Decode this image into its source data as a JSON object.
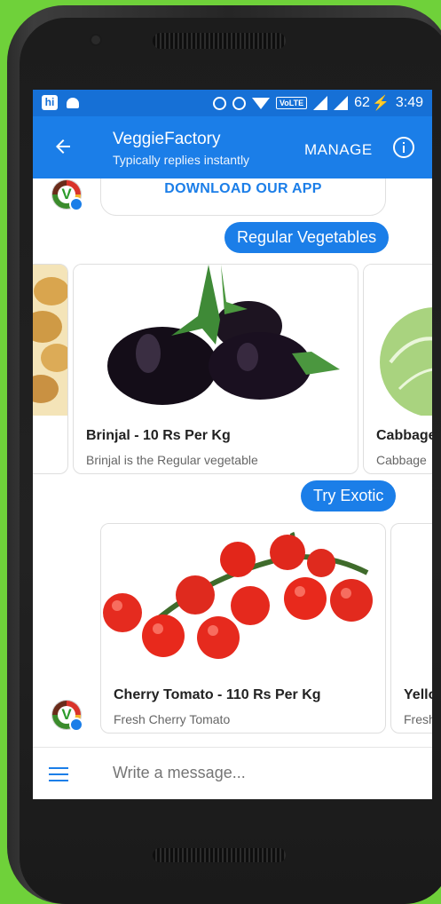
{
  "statusbar": {
    "hi": "hi",
    "volte": "VoLTE",
    "battery": "62",
    "time": "3:49"
  },
  "appbar": {
    "title": "VeggieFactory",
    "subtitle": "Typically replies instantly",
    "manage": "MANAGE"
  },
  "chat": {
    "download_button": "DOWNLOAD OUR APP",
    "bubble_regular": "Regular Vegetables",
    "regular_cards": [
      {
        "title": "Brinjal - 10 Rs Per Kg",
        "subtitle": "Brinjal is the Regular vegetable"
      },
      {
        "title": "Cabbage",
        "subtitle": "Cabbage"
      }
    ],
    "bubble_exotic": "Try Exotic",
    "exotic_cards": [
      {
        "title": "Cherry Tomato - 110 Rs Per Kg",
        "subtitle": "Fresh Cherry Tomato"
      },
      {
        "title": "Yello",
        "subtitle": "Fresh"
      }
    ],
    "avatar_letter": "V"
  },
  "composer": {
    "placeholder": "Write a message..."
  },
  "colors": {
    "brand": "#1b7ee8",
    "statusbar": "#1670d6",
    "background": "#6fd13a"
  },
  "icons": [
    "back-arrow-icon",
    "info-icon",
    "menu-icon",
    "wifi-icon",
    "signal-icon",
    "alarm-icon",
    "dnd-icon",
    "android-icon"
  ]
}
